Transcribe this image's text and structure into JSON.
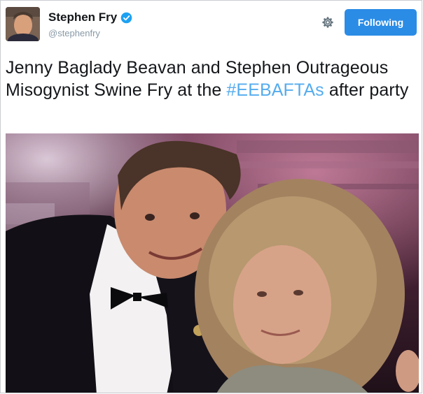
{
  "profile": {
    "display_name": "Stephen Fry",
    "handle": "@stephenfry",
    "verified": true,
    "avatar_icon": "avatar-photo"
  },
  "actions": {
    "settings_icon": "gear-icon",
    "follow_label": "Following"
  },
  "tweet": {
    "text_part1": "Jenny Baglady Beavan and Stephen Outrageous Misogynist Swine Fry at the ",
    "hashtag": "#EEBAFTAs",
    "text_part2": " after party"
  },
  "media": {
    "type": "photo",
    "description_icon": "party-photo"
  },
  "colors": {
    "follow_button": "#2b8ce6",
    "hashtag": "#55acee",
    "verified": "#1da1f2"
  }
}
